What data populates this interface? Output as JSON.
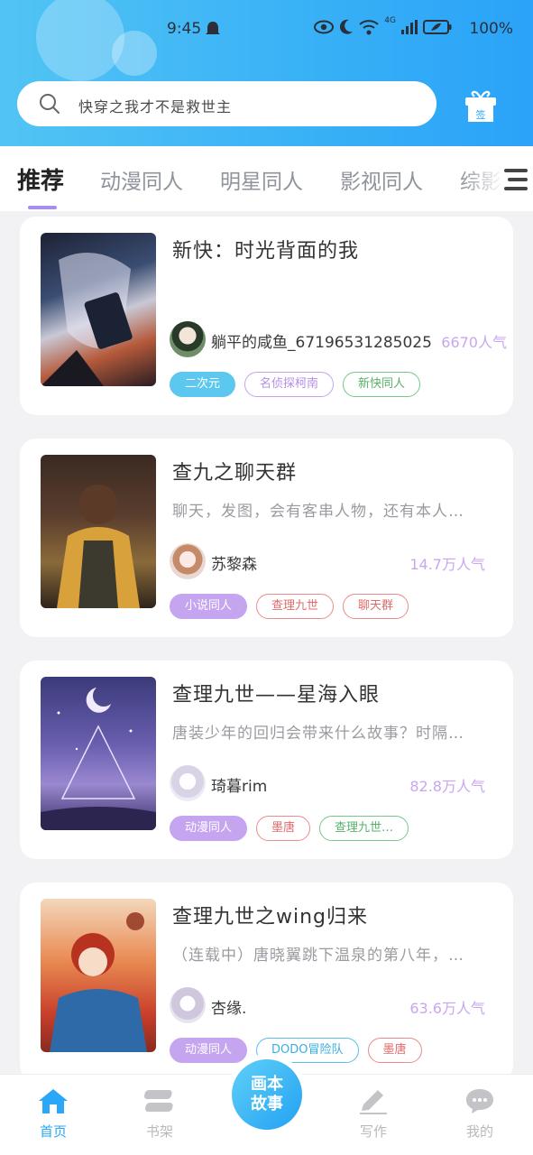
{
  "status_bar": {
    "time": "9:45",
    "battery": "100%",
    "network": "4G"
  },
  "search": {
    "placeholder": "快穿之我才不是救世主"
  },
  "checkin": {
    "label": "签"
  },
  "tabs": [
    {
      "label": "推荐",
      "active": true
    },
    {
      "label": "动漫同人",
      "active": false
    },
    {
      "label": "明星同人",
      "active": false
    },
    {
      "label": "影视同人",
      "active": false
    },
    {
      "label": "综影",
      "active": false
    }
  ],
  "stories": [
    {
      "title": "新快：时光背面的我",
      "desc": "",
      "author": "躺平的咸鱼_67196531285025",
      "popularity": "6670人气",
      "tags": [
        {
          "label": "二次元",
          "style": "f-cyan"
        },
        {
          "label": "名侦探柯南",
          "style": "o-purple"
        },
        {
          "label": "新快同人",
          "style": "o-green"
        }
      ]
    },
    {
      "title": "查九之聊天群",
      "desc": "聊天，发图，会有客串人物，还有本人…",
      "author": "苏黎森",
      "popularity": "14.7万人气",
      "tags": [
        {
          "label": "小说同人",
          "style": "f-purple"
        },
        {
          "label": "查理九世",
          "style": "o-red"
        },
        {
          "label": "聊天群",
          "style": "o-red"
        }
      ]
    },
    {
      "title": "查理九世——星海入眼",
      "desc": "唐装少年的回归会带来什么故事？时隔…",
      "author": "琦暮rim",
      "popularity": "82.8万人气",
      "tags": [
        {
          "label": "动漫同人",
          "style": "f-purple"
        },
        {
          "label": "墨唐",
          "style": "o-red"
        },
        {
          "label": "查理九世…",
          "style": "o-green"
        }
      ]
    },
    {
      "title": "查理九世之wing归来",
      "desc": "（连载中）唐晓翼跳下温泉的第八年，…",
      "author": "杏缘.",
      "popularity": "63.6万人气",
      "tags": [
        {
          "label": "动漫同人",
          "style": "f-purple"
        },
        {
          "label": "DODO冒险队",
          "style": "o-blue"
        },
        {
          "label": "墨唐",
          "style": "o-red"
        }
      ]
    }
  ],
  "bottom_nav": {
    "home": "首页",
    "shelf": "书架",
    "center_line1": "画本",
    "center_line2": "故事",
    "write": "写作",
    "me": "我的"
  },
  "colors": {
    "accent": "#2aa7f6",
    "tab_indicator": "#a88df0",
    "popularity": "#c9a7ee"
  }
}
